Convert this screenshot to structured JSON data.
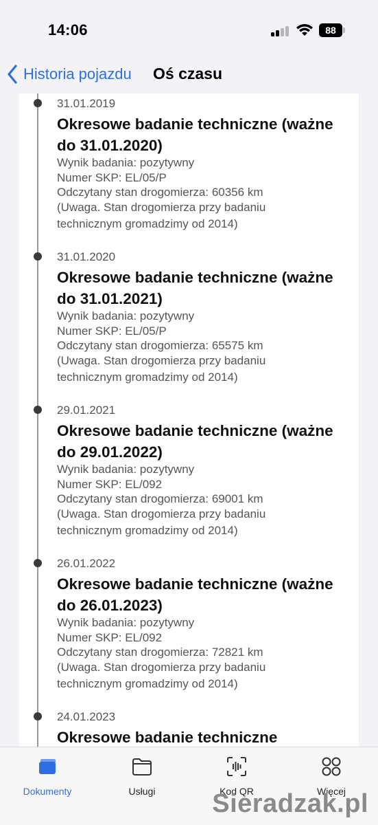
{
  "status_bar": {
    "time": "14:06",
    "battery": "88"
  },
  "nav": {
    "back_label": "Historia pojazdu",
    "title": "Oś czasu"
  },
  "timeline": [
    {
      "date": "31.01.2019",
      "title": "Okresowe badanie techniczne (ważne do 31.01.2020)",
      "details": [
        "Wynik badania: pozytywny",
        "Numer SKP: EL/05/P",
        "Odczytany stan drogomierza: 60356 km",
        "(Uwaga. Stan drogomierza przy badaniu",
        "technicznym gromadzimy od 2014)"
      ]
    },
    {
      "date": "31.01.2020",
      "title": "Okresowe badanie techniczne (ważne do 31.01.2021)",
      "details": [
        "Wynik badania: pozytywny",
        "Numer SKP: EL/05/P",
        "Odczytany stan drogomierza: 65575 km",
        "(Uwaga. Stan drogomierza przy badaniu",
        "technicznym gromadzimy od 2014)"
      ]
    },
    {
      "date": "29.01.2021",
      "title": "Okresowe badanie techniczne (ważne do 29.01.2022)",
      "details": [
        "Wynik badania: pozytywny",
        "Numer SKP: EL/092",
        "Odczytany stan drogomierza: 69001 km",
        "(Uwaga. Stan drogomierza przy badaniu",
        "technicznym gromadzimy od 2014)"
      ]
    },
    {
      "date": "26.01.2022",
      "title": "Okresowe badanie techniczne (ważne do 26.01.2023)",
      "details": [
        "Wynik badania: pozytywny",
        "Numer SKP: EL/092",
        "Odczytany stan drogomierza: 72821 km",
        "(Uwaga. Stan drogomierza przy badaniu",
        "technicznym gromadzimy od 2014)"
      ]
    },
    {
      "date": "24.01.2023",
      "title": "Okresowe badanie techniczne",
      "details": []
    }
  ],
  "tabs": [
    {
      "label": "Dokumenty",
      "icon": "documents-icon",
      "active": true
    },
    {
      "label": "Usługi",
      "icon": "folder-icon",
      "active": false
    },
    {
      "label": "Kod QR",
      "icon": "qr-scan-icon",
      "active": false
    },
    {
      "label": "Więcej",
      "icon": "more-grid-icon",
      "active": false
    }
  ],
  "watermark": "Sieradzak.pl",
  "colors": {
    "accent": "#2d6fe0",
    "background": "#f2f2f7"
  }
}
